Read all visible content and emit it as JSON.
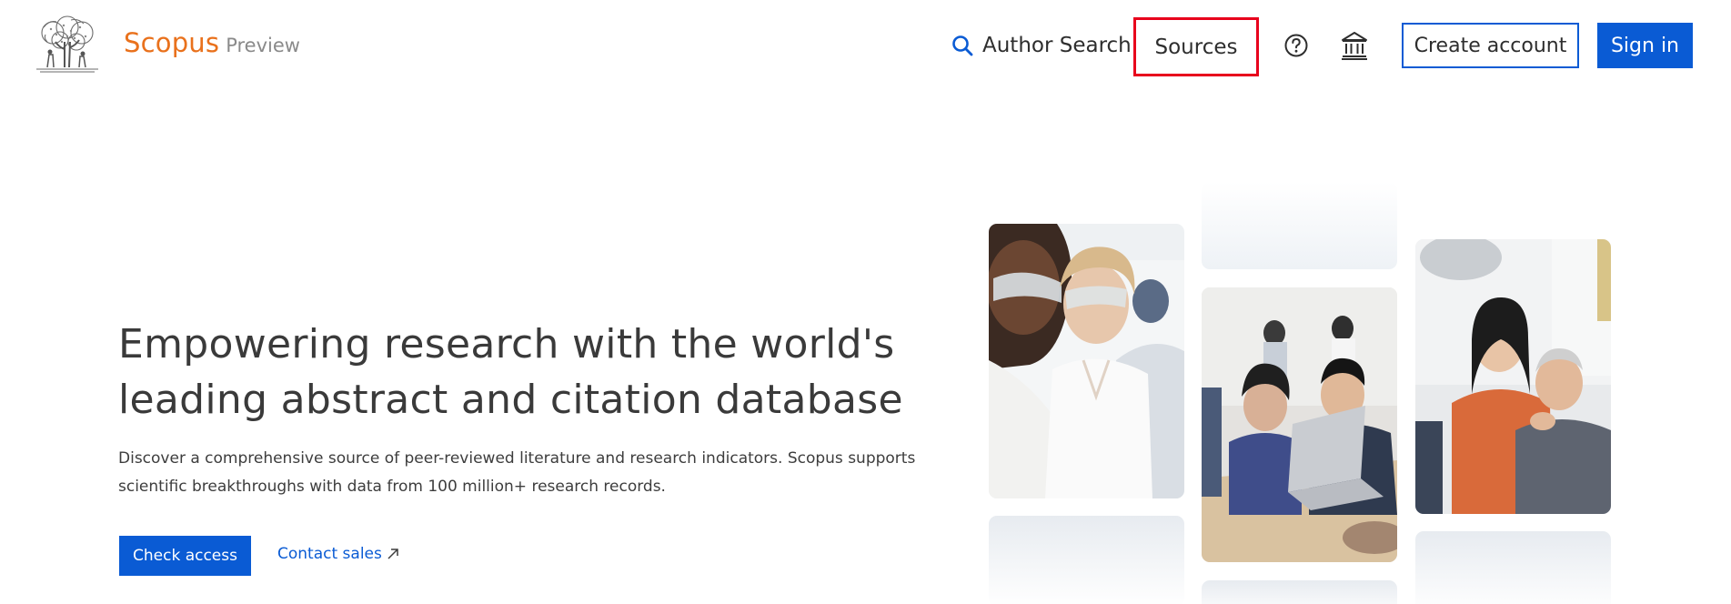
{
  "header": {
    "brand_name": "Scopus",
    "brand_sub": "Preview",
    "logo_icon": "elsevier-tree-logo",
    "nav": {
      "author_search_label": "Author Search",
      "author_search_icon": "search-icon",
      "sources_label": "Sources",
      "help_icon": "help-circle-icon",
      "institution_icon": "institution-icon"
    },
    "create_account_label": "Create account",
    "sign_in_label": "Sign in"
  },
  "hero": {
    "title_line1": "Empowering research with the world's",
    "title_line2": "leading abstract and citation database",
    "desc_line1": "Discover a comprehensive source of peer-reviewed literature and research indicators. Scopus supports",
    "desc_line2": "scientific breakthroughs with data from 100 million+ research records.",
    "check_access_label": "Check access",
    "contact_sales_label": "Contact sales",
    "contact_sales_icon": "external-arrow-icon"
  },
  "colors": {
    "brand_orange": "#e9711c",
    "primary_blue": "#0a5bd4",
    "highlight_red": "#e8001c",
    "text_dark": "#2e2e2e"
  }
}
